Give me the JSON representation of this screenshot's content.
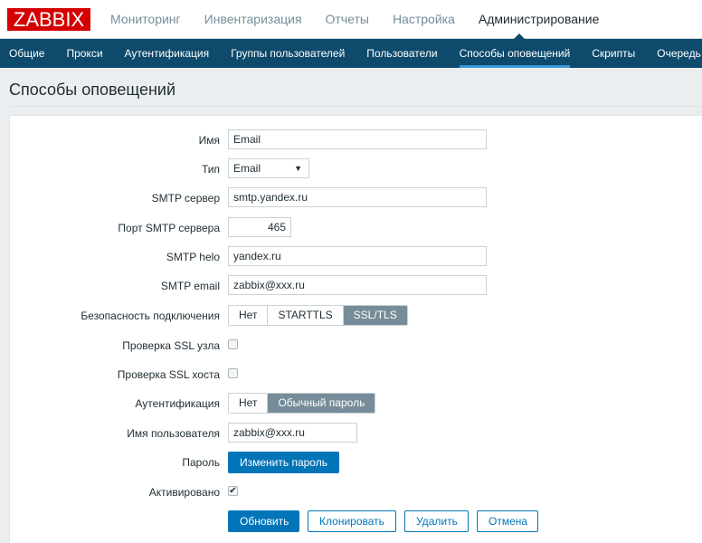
{
  "header": {
    "logo": "ZABBIX",
    "menu": [
      "Мониторинг",
      "Инвентаризация",
      "Отчеты",
      "Настройка",
      "Администрирование"
    ],
    "active_menu": 4
  },
  "subnav": {
    "items": [
      "Общие",
      "Прокси",
      "Аутентификация",
      "Группы пользователей",
      "Пользователи",
      "Способы оповещений",
      "Скрипты",
      "Очередь"
    ],
    "active": 5
  },
  "page_title": "Способы оповещений",
  "form": {
    "name": {
      "label": "Имя",
      "value": "Email"
    },
    "type": {
      "label": "Тип",
      "value": "Email"
    },
    "smtp_server": {
      "label": "SMTP сервер",
      "value": "smtp.yandex.ru"
    },
    "smtp_port": {
      "label": "Порт SMTP сервера",
      "value": "465"
    },
    "smtp_helo": {
      "label": "SMTP helo",
      "value": "yandex.ru"
    },
    "smtp_email": {
      "label": "SMTP email",
      "value": "zabbix@xxx.ru"
    },
    "security": {
      "label": "Безопасность подключения",
      "options": [
        "Нет",
        "STARTTLS",
        "SSL/TLS"
      ],
      "selected": "SSL/TLS"
    },
    "ssl_verify_peer": {
      "label": "Проверка SSL узла",
      "checked": false
    },
    "ssl_verify_host": {
      "label": "Проверка SSL хоста",
      "checked": false
    },
    "auth": {
      "label": "Аутентификация",
      "options": [
        "Нет",
        "Обычный пароль"
      ],
      "selected": "Обычный пароль"
    },
    "username": {
      "label": "Имя пользователя",
      "value": "zabbix@xxx.ru"
    },
    "password": {
      "label": "Пароль",
      "button": "Изменить пароль"
    },
    "enabled": {
      "label": "Активировано",
      "checked": true
    }
  },
  "buttons": {
    "update": "Обновить",
    "clone": "Клонировать",
    "delete": "Удалить",
    "cancel": "Отмена"
  }
}
